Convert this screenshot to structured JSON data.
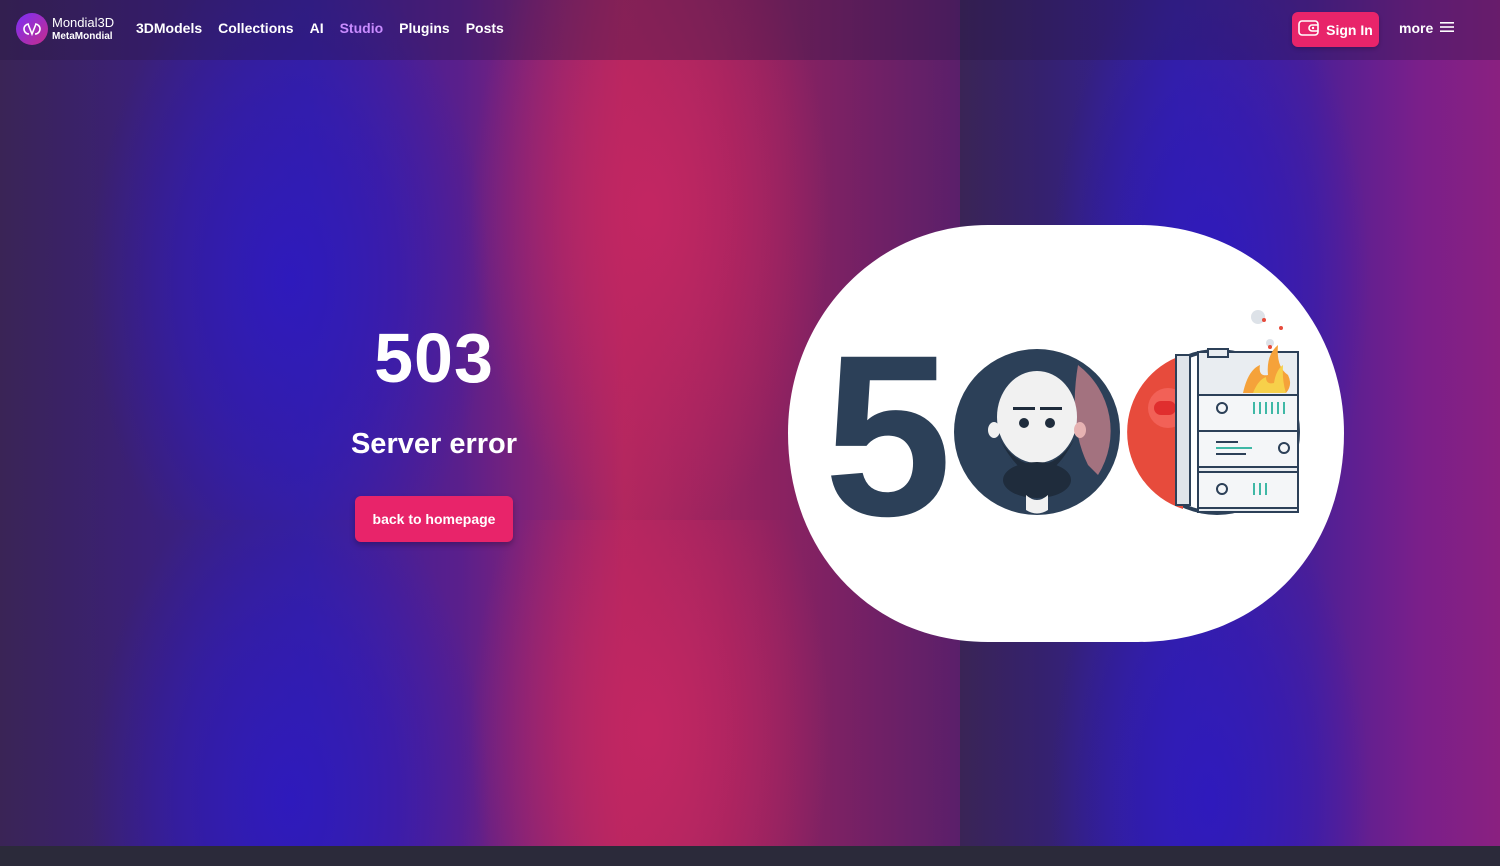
{
  "header": {
    "brand_name": "Mondial3D",
    "brand_sub": "MetaMondial",
    "nav": [
      {
        "label": "3DModels",
        "active": false
      },
      {
        "label": "Collections",
        "active": false
      },
      {
        "label": "AI",
        "active": false
      },
      {
        "label": "Studio",
        "active": true
      },
      {
        "label": "Plugins",
        "active": false
      },
      {
        "label": "Posts",
        "active": false
      }
    ],
    "signin_label": "Sign In",
    "more_label": "more"
  },
  "error": {
    "code": "503",
    "title": "Server error",
    "back_label": "back to homepage"
  },
  "illustration": {
    "digit_label": "5",
    "icons": [
      "bearded-man-icon",
      "burning-server-icon"
    ]
  },
  "colors": {
    "accent": "#e8246a",
    "nav_active": "#c98cff",
    "illus_navy": "#2c4058"
  }
}
